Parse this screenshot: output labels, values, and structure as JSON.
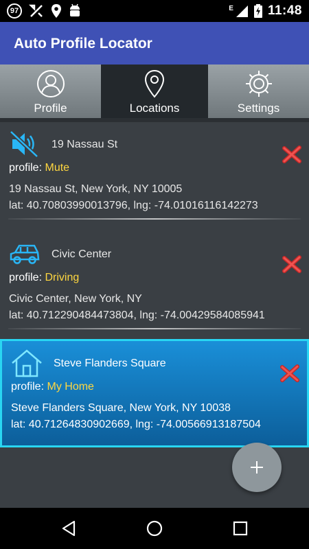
{
  "status_bar": {
    "notification_badge": "97",
    "network_type": "E",
    "time": "11:48",
    "icons": [
      "badge-97-icon",
      "tools-icon",
      "location-pin-icon",
      "android-icon",
      "signal-icon",
      "battery-charging-icon"
    ]
  },
  "app_bar": {
    "title": "Auto Profile Locator",
    "color": "#3f51b5"
  },
  "tabs": [
    {
      "label": "Profile",
      "icon": "person-icon",
      "selected": false
    },
    {
      "label": "Locations",
      "icon": "map-pin-icon",
      "selected": true
    },
    {
      "label": "Settings",
      "icon": "gear-icon",
      "selected": false
    }
  ],
  "locations": [
    {
      "name": "19 Nassau St",
      "icon": "mute-speaker-icon",
      "profile_label": "profile:",
      "profile_value": "Mute",
      "address": "19 Nassau St, New York, NY 10005",
      "coordinates": "lat: 40.70803990013796, lng: -74.01016116142273",
      "selected": false
    },
    {
      "name": "Civic Center",
      "icon": "car-icon",
      "profile_label": "profile:",
      "profile_value": "Driving",
      "address": "Civic Center, New York, NY",
      "coordinates": "lat: 40.712290484473804, lng: -74.00429584085941",
      "selected": false
    },
    {
      "name": "Steve Flanders Square",
      "icon": "home-icon",
      "profile_label": "profile:",
      "profile_value": "My Home",
      "address": "Steve Flanders Square, New York, NY 10038",
      "coordinates": "lat: 40.71264830902669, lng: -74.00566913187504",
      "selected": true
    }
  ],
  "fab": {
    "icon": "plus-icon"
  },
  "nav_bar": {
    "icons": [
      "back-icon",
      "home-circle-icon",
      "recents-icon"
    ]
  },
  "colors": {
    "accent": "#29d6f2",
    "profile_value": "#ffd740",
    "delete": "#e53935"
  }
}
